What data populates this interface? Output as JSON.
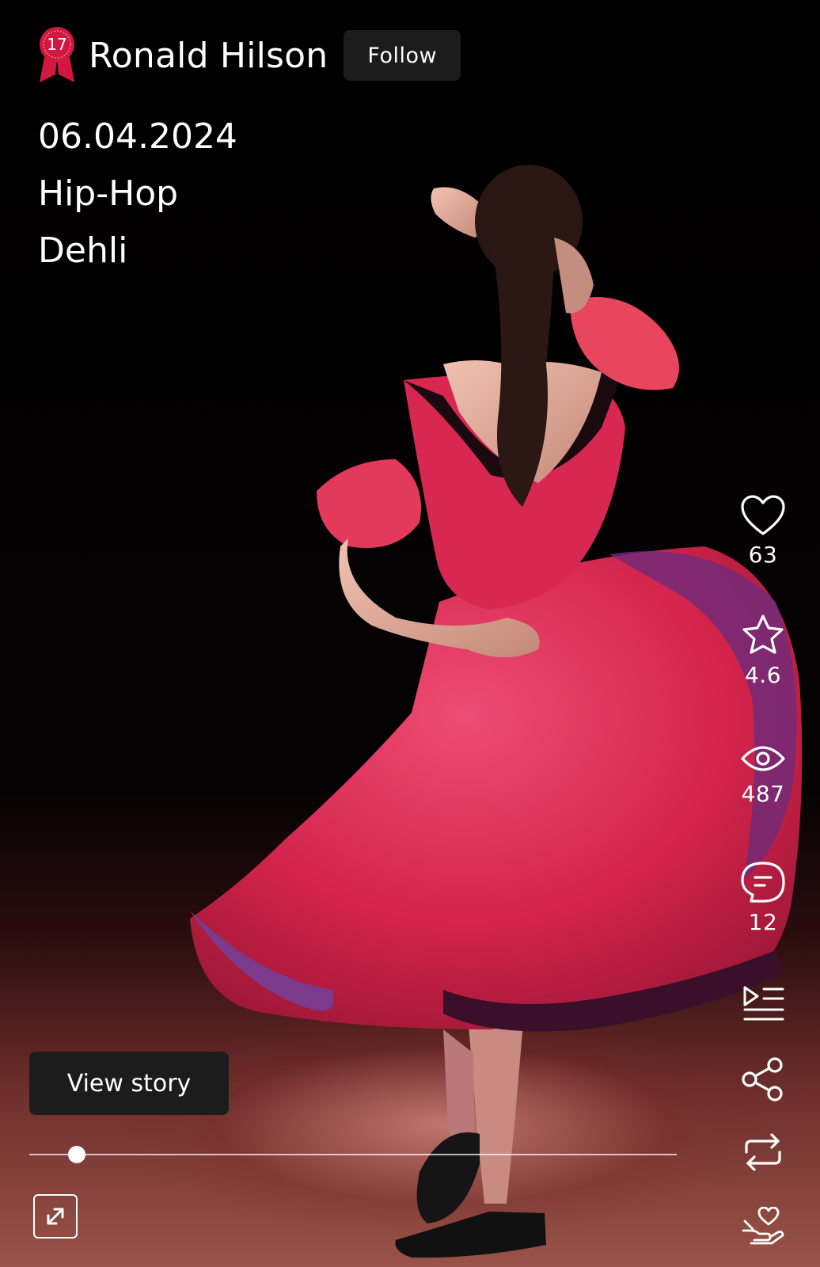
{
  "header": {
    "badge_number": "17",
    "username": "Ronald Hilson",
    "follow_label": "Follow"
  },
  "post": {
    "date": "06.04.2024",
    "genre": "Hip-Hop",
    "location": "Dehli"
  },
  "actions": {
    "likes": "63",
    "rating": "4.6",
    "views": "487",
    "comments": "12",
    "icons": [
      "heart-icon",
      "star-icon",
      "eye-icon",
      "comment-icon",
      "playlist-icon",
      "share-icon",
      "repost-icon",
      "donate-icon"
    ]
  },
  "player": {
    "view_story_label": "View story",
    "progress": 0.073
  },
  "colors": {
    "badge": "#d3183f",
    "button_bg": "#1c1c1c",
    "dress": "#e22a55"
  }
}
